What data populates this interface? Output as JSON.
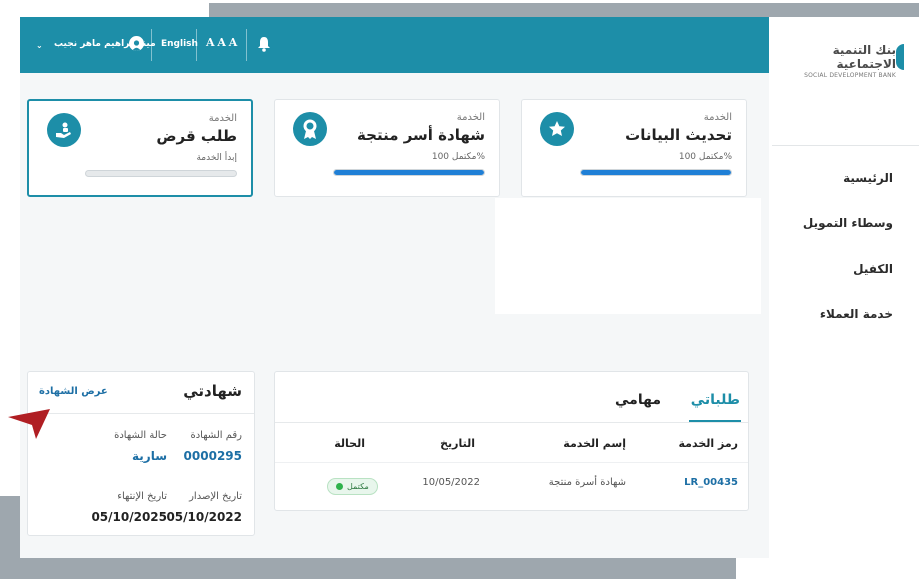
{
  "brand": {
    "name_ar": "بنك التنمية الاجتماعية",
    "name_en": "SOCIAL DEVELOPMENT BANK"
  },
  "topbar": {
    "user_name": "مينا إبراهيم ماهر نجيب",
    "language": "English",
    "font_size": "A A A"
  },
  "nav": {
    "items": [
      {
        "label": "الرئيسية"
      },
      {
        "label": "وسطاء التمويل"
      },
      {
        "label": "الكفيل"
      },
      {
        "label": "خدمة العملاء"
      }
    ]
  },
  "cards": [
    {
      "kicker": "الخدمة",
      "title": "تحديث البيانات",
      "status": "مكتمل 100%",
      "progress": 1.0,
      "icon": "star-icon"
    },
    {
      "kicker": "الخدمة",
      "title": "شهادة أسر منتجة",
      "status": "مكتمل 100%",
      "progress": 1.0,
      "icon": "award-icon"
    },
    {
      "kicker": "الخدمة",
      "title": "طلب قرض",
      "status": "إبدأ الخدمة",
      "progress": 0.0,
      "icon": "loan-hand-icon"
    }
  ],
  "certificates": {
    "title": "شهادتي",
    "view_link": "عرض الشهادة",
    "cert_number_label": "رقم الشهادة",
    "cert_number": "0000295",
    "cert_status_label": "حالة الشهادة",
    "cert_status": "سارية",
    "issue_date_label": "تاريخ الإصدار",
    "issue_date": "05/10/2022",
    "end_date_label": "تاريخ الإنتهاء",
    "end_date": "05/10/2025"
  },
  "requests": {
    "tabs": [
      "طلباتي",
      "مهامي"
    ],
    "columns": [
      "رمز الخدمة",
      "إسم الخدمة",
      "التاريخ",
      "الحالة"
    ],
    "rows": [
      {
        "code": "LR_00435",
        "service": "شهادة أسرة منتجة",
        "date": "10/05/2022",
        "status": "مكتمل"
      }
    ]
  },
  "colors": {
    "primary": "#1d8ea8",
    "progress": "#1f7fd6",
    "link": "#1d6fa5",
    "pointer": "#b01e23",
    "success": "#2fb24c"
  }
}
